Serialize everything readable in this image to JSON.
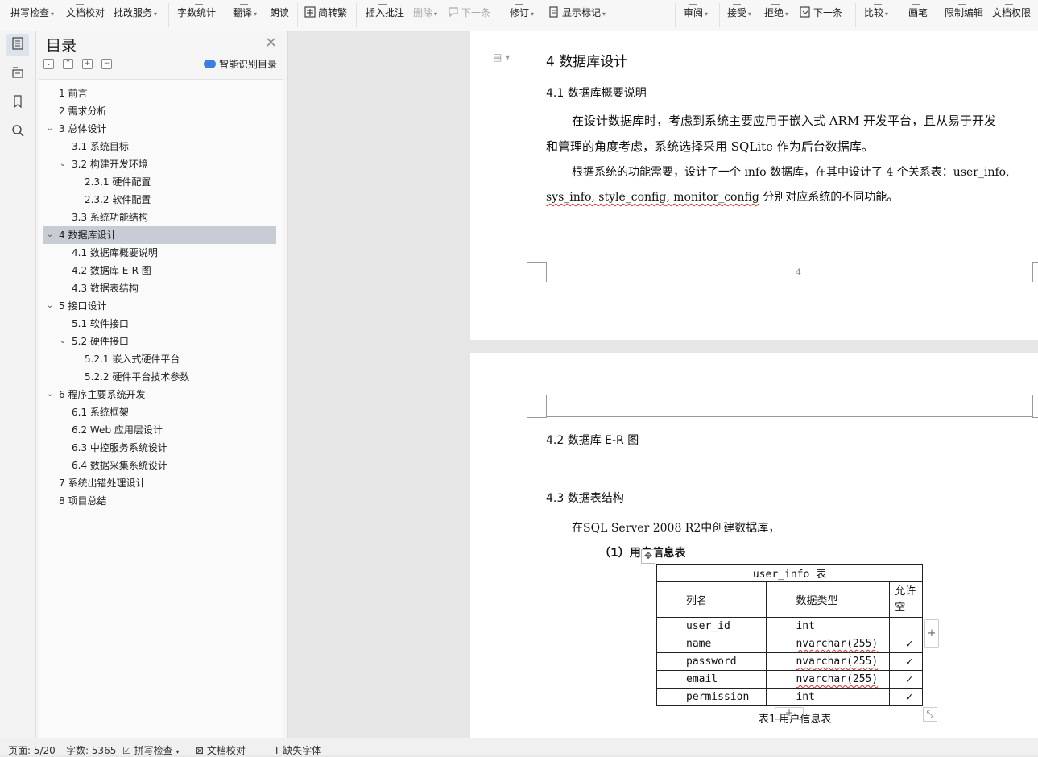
{
  "ribbon": {
    "items": [
      {
        "label": "拼写检查",
        "caret": true,
        "disabled": false
      },
      {
        "label": "文档校对",
        "caret": false,
        "disabled": false
      },
      {
        "label": "批改服务",
        "caret": true,
        "disabled": false
      },
      {
        "label": "字数统计",
        "caret": false,
        "disabled": false
      },
      {
        "label": "翻译",
        "caret": true,
        "disabled": false
      },
      {
        "label": "朗读",
        "caret": false,
        "disabled": false
      },
      {
        "label": "简转繁",
        "caret": false,
        "disabled": false
      },
      {
        "label": "插入批注",
        "caret": false,
        "disabled": false
      },
      {
        "label": "删除",
        "caret": true,
        "disabled": true
      },
      {
        "label": "下一条",
        "caret": false,
        "disabled": true
      },
      {
        "label": "修订",
        "caret": true,
        "disabled": false
      },
      {
        "label": "显示标记",
        "caret": true,
        "disabled": false
      },
      {
        "label": "审阅",
        "caret": true,
        "disabled": false
      },
      {
        "label": "接受",
        "caret": true,
        "disabled": false
      },
      {
        "label": "拒绝",
        "caret": true,
        "disabled": false
      },
      {
        "label": "下一条",
        "caret": false,
        "disabled": false
      },
      {
        "label": "比较",
        "caret": true,
        "disabled": false
      },
      {
        "label": "画笔",
        "caret": false,
        "disabled": false
      },
      {
        "label": "限制编辑",
        "caret": false,
        "disabled": false
      },
      {
        "label": "文档权限",
        "caret": false,
        "disabled": false
      }
    ]
  },
  "toc": {
    "title": "目录",
    "smart_label": "智能识别目录",
    "items": [
      {
        "label": "1  前言"
      },
      {
        "label": "2  需求分析"
      },
      {
        "label": "3  总体设计"
      },
      {
        "label": "3.1  系统目标"
      },
      {
        "label": "3.2  构建开发环境"
      },
      {
        "label": "2.3.1 硬件配置"
      },
      {
        "label": "2.3.2 软件配置"
      },
      {
        "label": "3.3  系统功能结构"
      },
      {
        "label": "4  数据库设计"
      },
      {
        "label": "4.1  数据库概要说明"
      },
      {
        "label": "4.2  数据库 E-R 图"
      },
      {
        "label": "4.3  数据表结构"
      },
      {
        "label": "5  接口设计"
      },
      {
        "label": "5.1 软件接口"
      },
      {
        "label": "5.2 硬件接口"
      },
      {
        "label": "5.2.1  嵌入式硬件平台"
      },
      {
        "label": "5.2.2  硬件平台技术参数"
      },
      {
        "label": "6  程序主要系统开发"
      },
      {
        "label": "6.1  系统框架"
      },
      {
        "label": "6.2 Web 应用层设计"
      },
      {
        "label": "6.3  中控服务系统设计"
      },
      {
        "label": "6.4  数据采集系统设计"
      },
      {
        "label": "7  系统出错处理设计"
      },
      {
        "label": "8  项目总结"
      }
    ]
  },
  "doc": {
    "h1": "4  数据库设计",
    "h41": "4.1  数据库概要说明",
    "p1a": "在设计数据库时，考虑到系统主要应用于嵌入式 ARM 开发平台，且从易于开发",
    "p1b": "和管理的角度考虑，系统选择采用 SQLite 作为后台数据库。",
    "p2a": "根据系统的功能需要，设计了一个 info 数据库，在其中设计了 4 个关系表：user_info,",
    "p2b_link": "sys_info, style_config, monitor_config",
    "p2b_rest": "  分别对应系统的不同功能。",
    "page_number": "4",
    "h42": "4.2  数据库 E-R 图",
    "h43": "4.3  数据表结构",
    "p3": "在SQL Server 2008 R2中创建数据库，",
    "h_table": "（1）用户信息表",
    "table": {
      "caption": "user_info 表",
      "headers": [
        "列名",
        "数据类型",
        "允许空"
      ],
      "rows": [
        [
          "user_id",
          "int",
          ""
        ],
        [
          "name",
          "nvarchar(255)",
          "✓"
        ],
        [
          "password",
          "nvarchar(255)",
          "✓"
        ],
        [
          "email",
          "nvarchar(255)",
          "✓"
        ],
        [
          "permission",
          "int",
          "✓"
        ]
      ],
      "footer": "表1 用户信息表"
    }
  },
  "status": {
    "page": "页面: 5/20",
    "words": "字数: 5365",
    "spell": "拼写检查",
    "proof": "文档校对",
    "missing_font": "缺失字体"
  },
  "colors": {
    "selection": "#c8cdd5",
    "accent": "#3d7fe0"
  }
}
